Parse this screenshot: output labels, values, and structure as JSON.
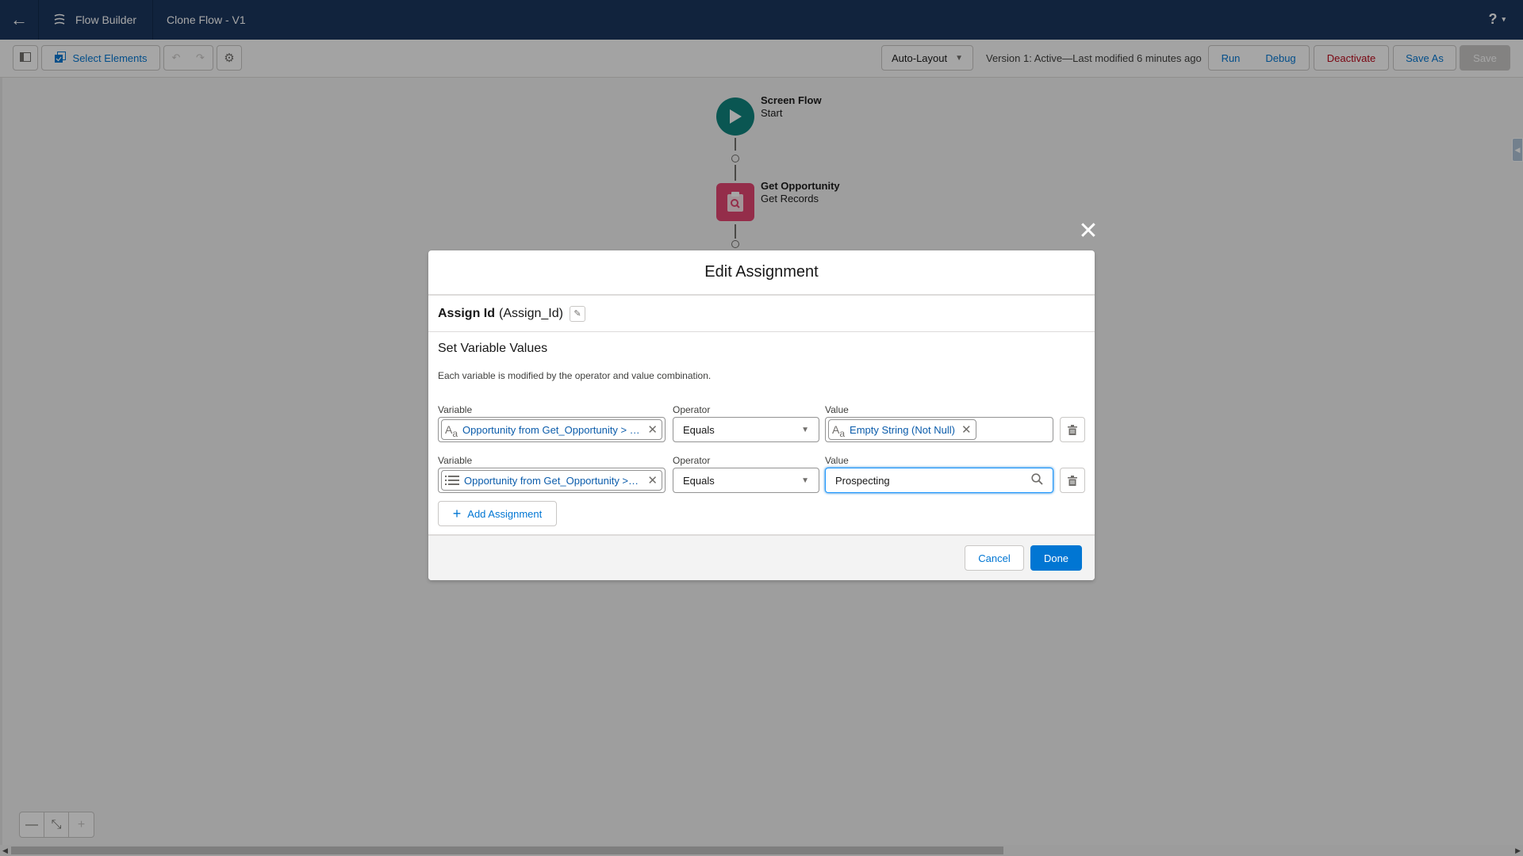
{
  "topbar": {
    "back_icon": "arrow-left-icon",
    "app_icon": "flow-icon",
    "app_name": "Flow Builder",
    "flow_name": "Clone Flow - V1",
    "help_label": "?",
    "help_caret": "▾"
  },
  "toolbar": {
    "toggle_panel_icon": "panel-toggle-icon",
    "select_elements_label": "Select Elements",
    "undo_icon": "undo-icon",
    "redo_icon": "redo-icon",
    "settings_icon": "gear-icon",
    "layout_select": "Auto-Layout",
    "version_status": "Version 1: Active—Last modified 6 minutes ago",
    "run_label": "Run",
    "debug_label": "Debug",
    "deactivate_label": "Deactivate",
    "save_as_label": "Save As",
    "save_label": "Save"
  },
  "canvas": {
    "nodes": [
      {
        "title": "Screen Flow",
        "subtitle": "Start",
        "icon": "play-icon",
        "color": "#0b827c"
      },
      {
        "title": "Get Opportunity",
        "subtitle": "Get Records",
        "icon": "clipboard-search-icon",
        "color": "#e3436f"
      }
    ],
    "zoom_controls": {
      "zoom_out": "—",
      "fit": "⤡",
      "zoom_in": "+"
    }
  },
  "modal": {
    "title": "Edit Assignment",
    "element_label": "Assign Id",
    "element_api_name": "(Assign_Id)",
    "section_title": "Set Variable Values",
    "section_description": "Each variable is modified by the operator and value combination.",
    "labels": {
      "variable": "Variable",
      "operator": "Operator",
      "value": "Value"
    },
    "rows": [
      {
        "variable_type_icon": "text-type-icon",
        "variable": "Opportunity from Get_Opportunity > O...",
        "operator": "Equals",
        "value_type_icon": "text-type-icon",
        "value_pill": "Empty String (Not Null)",
        "value_text": ""
      },
      {
        "variable_type_icon": "picklist-type-icon",
        "variable": "Opportunity from Get_Opportunity > S...",
        "operator": "Equals",
        "value_pill": "",
        "value_text": "Prospecting"
      }
    ],
    "add_assignment_label": "Add Assignment",
    "cancel_label": "Cancel",
    "done_label": "Done"
  },
  "colors": {
    "brand_header": "#16325c",
    "primary": "#0176d3",
    "destructive": "#ba0517",
    "start_node": "#0b827c",
    "get_records_node": "#e3436f"
  }
}
